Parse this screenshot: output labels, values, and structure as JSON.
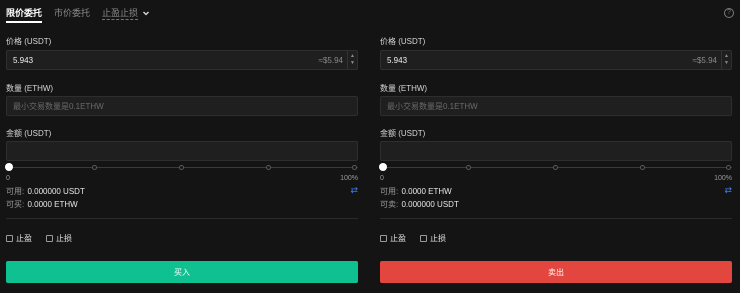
{
  "tabs": [
    {
      "label": "限价委托",
      "active": true
    },
    {
      "label": "市价委托",
      "active": false
    },
    {
      "label": "止盈止损",
      "active": false,
      "dropdown": true
    }
  ],
  "help_icon": "?",
  "buy": {
    "price_label": "价格 (USDT)",
    "price_value": "5.943",
    "price_approx": "≈$5.94",
    "qty_label": "数量 (ETHW)",
    "qty_placeholder": "最小交易数量是0.1ETHW",
    "amount_label": "金额 (USDT)",
    "slider_min": "0",
    "slider_max": "100%",
    "slider_value": 0,
    "available_label": "可用:",
    "available_value": "0.000000 USDT",
    "can_trade_label": "可买:",
    "can_trade_value": "0.0000 ETHW",
    "tp_label": "止盈",
    "sl_label": "止损",
    "button_label": "买入",
    "button_color": "#0fc191"
  },
  "sell": {
    "price_label": "价格 (USDT)",
    "price_value": "5.943",
    "price_approx": "≈$5.94",
    "qty_label": "数量 (ETHW)",
    "qty_placeholder": "最小交易数量是0.1ETHW",
    "amount_label": "金额 (USDT)",
    "slider_min": "0",
    "slider_max": "100%",
    "slider_value": 0,
    "available_label": "可用:",
    "available_value": "0.0000 ETHW",
    "can_trade_label": "可卖:",
    "can_trade_value": "0.000000 USDT",
    "tp_label": "止盈",
    "sl_label": "止损",
    "button_label": "卖出",
    "button_color": "#e2463e"
  }
}
